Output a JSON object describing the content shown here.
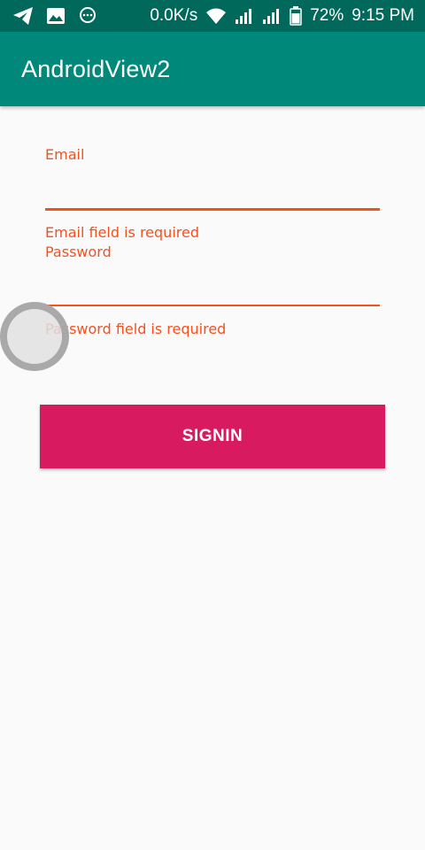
{
  "status_bar": {
    "net_speed": "0.0K/s",
    "battery_percent": "72%",
    "time": "9:15 PM",
    "icons": [
      "telegram-icon",
      "image-icon",
      "chat-icon",
      "wifi-icon",
      "signal-icon",
      "signal-icon",
      "battery-icon"
    ]
  },
  "app_bar": {
    "title": "AndroidView2",
    "color": "#00897b"
  },
  "form": {
    "email": {
      "label": "Email",
      "value": "",
      "error": "Email field is required"
    },
    "password": {
      "label": "Password",
      "value": "",
      "error": "Password field is required"
    },
    "error_color": "#f4511e",
    "signin_label": "SIGNIN",
    "signin_color": "#d81b60"
  }
}
